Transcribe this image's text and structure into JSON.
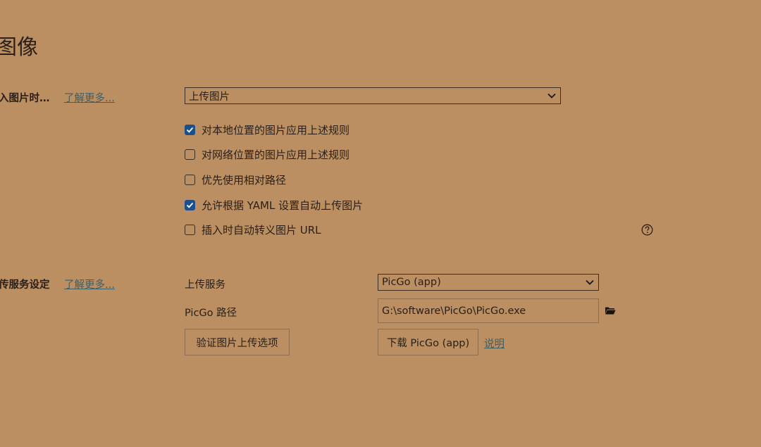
{
  "section": {
    "title": "图像"
  },
  "insert_image": {
    "label": "入图片时…",
    "learn_more": "了解更多...",
    "action_select": {
      "value": "上传图片"
    },
    "options": [
      {
        "label": "对本地位置的图片应用上述规则",
        "checked": true
      },
      {
        "label": "对网络位置的图片应用上述规则",
        "checked": false
      },
      {
        "label": "优先使用相对路径",
        "checked": false
      },
      {
        "label": "允许根据 YAML 设置自动上传图片",
        "checked": true
      },
      {
        "label": "插入时自动转义图片 URL",
        "checked": false
      }
    ],
    "help_icon": "question-circle-icon"
  },
  "upload_service": {
    "label": "传服务设定",
    "learn_more": "了解更多...",
    "service_label": "上传服务",
    "service_select": {
      "value": "PicGo (app)"
    },
    "path_label": "PicGo 路径",
    "path_value": "G:\\software\\PicGo\\PicGo.exe",
    "folder_icon": "folder-icon",
    "verify_button": "验证图片上传选项",
    "download_button": "下载 PicGo (app)",
    "doc_link": "说明"
  },
  "colors": {
    "background": "#bb8f61",
    "checkbox_checked": "#1e4f8d",
    "link": "#3f5f66"
  }
}
